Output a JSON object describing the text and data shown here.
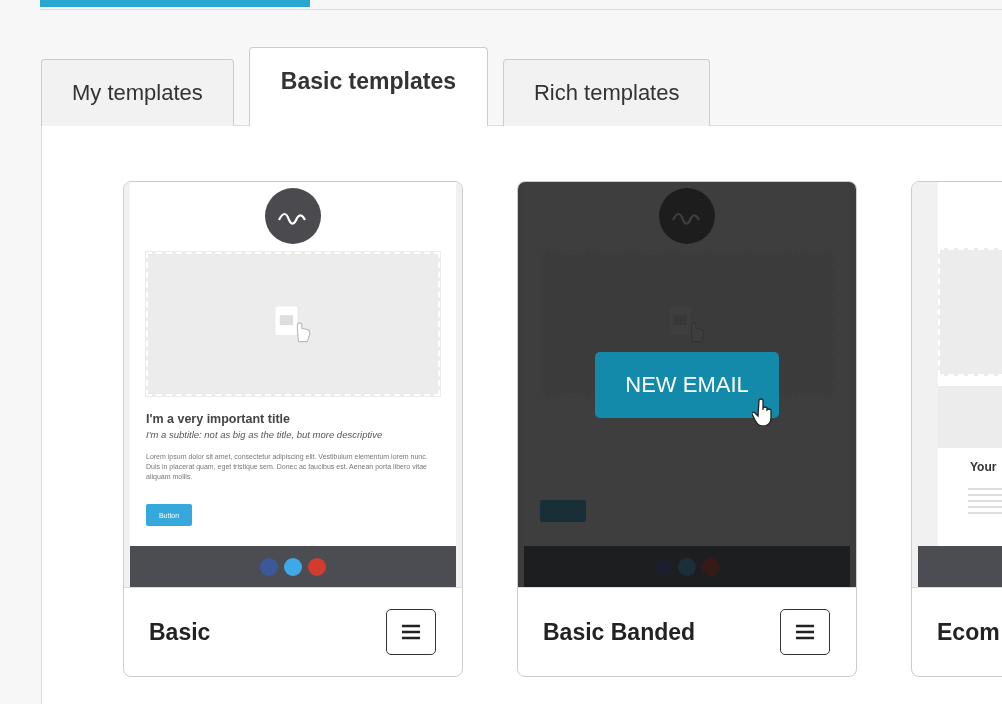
{
  "tabs": [
    {
      "label": "My templates",
      "selected": false
    },
    {
      "label": "Basic templates",
      "selected": true
    },
    {
      "label": "Rich templates",
      "selected": false
    }
  ],
  "templates": [
    {
      "name": "Basic",
      "hovered": false,
      "preview": {
        "kind": "basic",
        "title": "I'm a very important title",
        "subtitle": "I'm a subtitle: not as big as the title, but more descriptive",
        "body": "Lorem ipsum dolor sit amet, consectetur adipiscing elit. Vestibulum elementum lorem nunc. Duis in placerat quam, eget tristique sem. Donec ac faucibus est. Aenean porta libero vitae aliquam mollis.",
        "button": "Button"
      }
    },
    {
      "name": "Basic Banded",
      "hovered": true,
      "action": "NEW EMAIL",
      "preview": {
        "kind": "basic"
      }
    },
    {
      "name": "Ecom",
      "hovered": false,
      "preview": {
        "kind": "ecommerce",
        "title": "Your"
      }
    }
  ]
}
